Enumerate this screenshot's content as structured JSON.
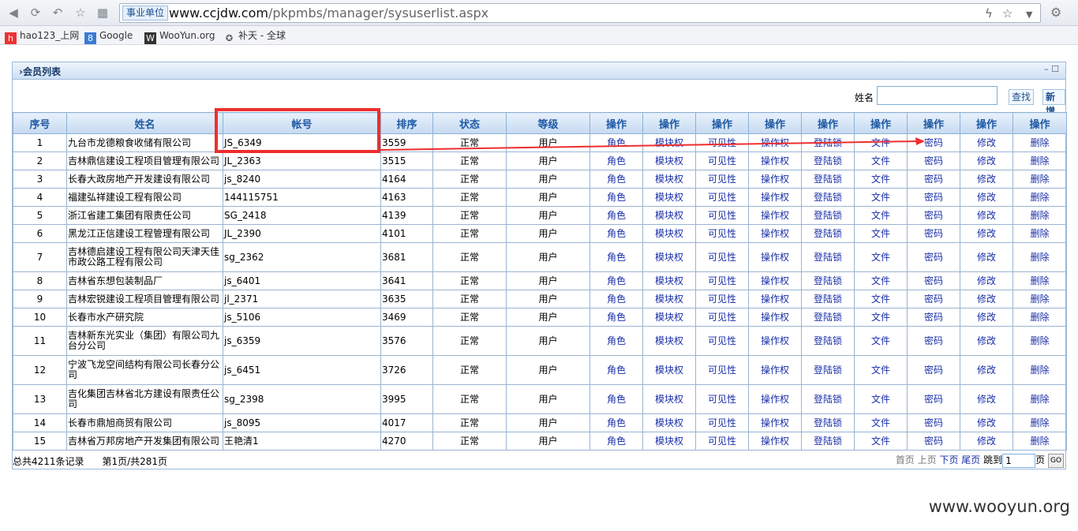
{
  "browser": {
    "address_badge": "事业单位",
    "url_host": "www.ccjdw.com",
    "url_path": "/pkpmbs/manager/sysuserlist.aspx",
    "bookmarks": [
      {
        "label": "hao123_上网"
      },
      {
        "label": "Google"
      },
      {
        "label": "WooYun.org"
      },
      {
        "label": "补天 - 全球"
      }
    ]
  },
  "panel": {
    "title": "会员列表",
    "controls": "– ☐"
  },
  "search": {
    "label": "姓名",
    "value": "",
    "button_label": "查找",
    "add_label": "新增"
  },
  "table": {
    "headers": [
      "序号",
      "姓名",
      "帐号",
      "排序",
      "状态",
      "等级",
      "操作",
      "操作",
      "操作",
      "操作",
      "操作",
      "操作",
      "操作",
      "操作",
      "操作"
    ],
    "rows": [
      {
        "no": "1",
        "name": "九台市龙德粮食收储有限公司",
        "account": "JS_6349",
        "sort": "3559",
        "status": "正常",
        "level": "用户"
      },
      {
        "no": "2",
        "name": "吉林鼎信建设工程项目管理有限公司",
        "account": "JL_2363",
        "sort": "3515",
        "status": "正常",
        "level": "用户"
      },
      {
        "no": "3",
        "name": "长春大政房地产开发建设有限公司",
        "account": "js_8240",
        "sort": "4164",
        "status": "正常",
        "level": "用户"
      },
      {
        "no": "4",
        "name": "福建弘祥建设工程有限公司",
        "account": "144115751",
        "sort": "4163",
        "status": "正常",
        "level": "用户"
      },
      {
        "no": "5",
        "name": "浙江省建工集团有限责任公司",
        "account": "SG_2418",
        "sort": "4139",
        "status": "正常",
        "level": "用户"
      },
      {
        "no": "6",
        "name": "黑龙江正信建设工程管理有限公司",
        "account": "JL_2390",
        "sort": "4101",
        "status": "正常",
        "level": "用户"
      },
      {
        "no": "7",
        "name": "吉林德启建设工程有限公司天津天佳市政公路工程有限公司",
        "account": "sg_2362",
        "sort": "3681",
        "status": "正常",
        "level": "用户"
      },
      {
        "no": "8",
        "name": "吉林省东想包装制品厂",
        "account": "js_6401",
        "sort": "3641",
        "status": "正常",
        "level": "用户"
      },
      {
        "no": "9",
        "name": "吉林宏锐建设工程项目管理有限公司",
        "account": "jl_2371",
        "sort": "3635",
        "status": "正常",
        "level": "用户"
      },
      {
        "no": "10",
        "name": "长春市水产研究院",
        "account": "js_5106",
        "sort": "3469",
        "status": "正常",
        "level": "用户"
      },
      {
        "no": "11",
        "name": "吉林新东光实业（集团）有限公司九台分公司",
        "account": "js_6359",
        "sort": "3576",
        "status": "正常",
        "level": "用户"
      },
      {
        "no": "12",
        "name": "宁波飞龙空间结构有限公司长春分公司",
        "account": "js_6451",
        "sort": "3726",
        "status": "正常",
        "level": "用户"
      },
      {
        "no": "13",
        "name": "吉化集团吉林省北方建设有限责任公司",
        "account": "sg_2398",
        "sort": "3995",
        "status": "正常",
        "level": "用户"
      },
      {
        "no": "14",
        "name": "长春市鼎旭商贸有限公司",
        "account": "js_8095",
        "sort": "4017",
        "status": "正常",
        "level": "用户"
      },
      {
        "no": "15",
        "name": "吉林省万邦房地产开发集团有限公司",
        "account": "王艳清1",
        "sort": "4270",
        "status": "正常",
        "level": "用户"
      }
    ],
    "actions": [
      "角色",
      "模块权",
      "可见性",
      "操作权",
      "登陆锁",
      "文件",
      "密码",
      "修改",
      "删除"
    ]
  },
  "pager": {
    "summary": "总共4211条记录",
    "page_info": "第1页/共281页",
    "first": "首页",
    "prev": "上页",
    "next": "下页",
    "last": "尾页",
    "jump_label": "跳到",
    "page_value": "1",
    "page_unit": "页",
    "go": "GO"
  },
  "watermark": "www.wooyun.org",
  "colors": {
    "link": "#1a2fa8",
    "header_text": "#1f5aa4",
    "annotation": "#ee2e2e"
  }
}
